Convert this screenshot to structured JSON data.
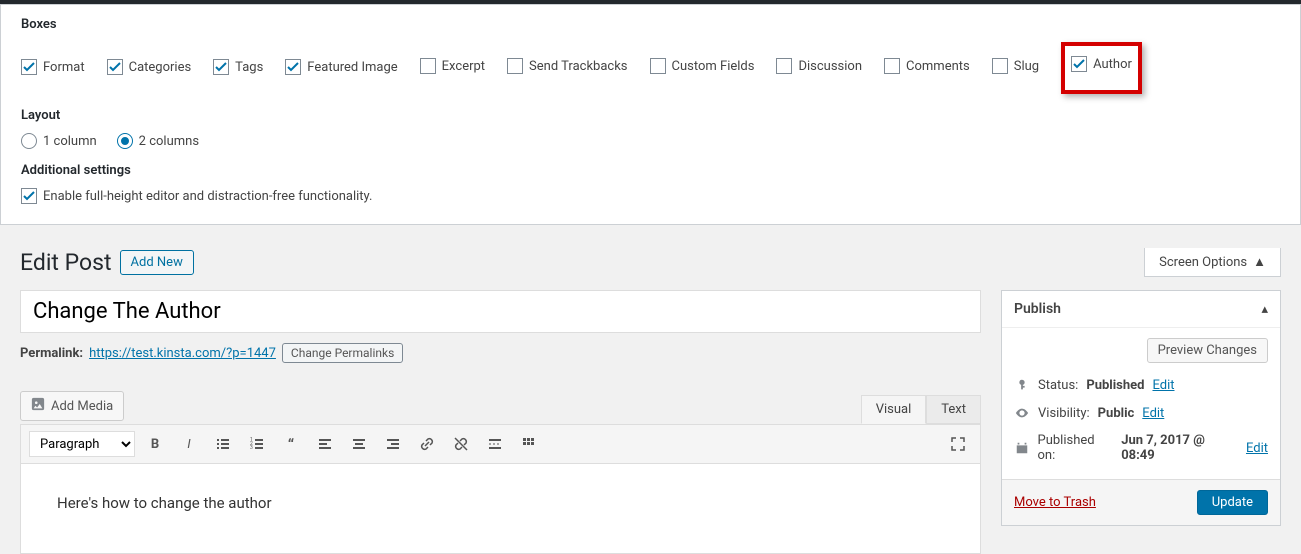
{
  "screen_options": {
    "sections": {
      "boxes_heading": "Boxes",
      "layout_heading": "Layout",
      "additional_heading": "Additional settings"
    },
    "boxes": [
      {
        "id": "format",
        "label": "Format",
        "checked": true
      },
      {
        "id": "categories",
        "label": "Categories",
        "checked": true
      },
      {
        "id": "tags",
        "label": "Tags",
        "checked": true
      },
      {
        "id": "featured-image",
        "label": "Featured Image",
        "checked": true
      },
      {
        "id": "excerpt",
        "label": "Excerpt",
        "checked": false
      },
      {
        "id": "trackbacks",
        "label": "Send Trackbacks",
        "checked": false
      },
      {
        "id": "custom-fields",
        "label": "Custom Fields",
        "checked": false
      },
      {
        "id": "discussion",
        "label": "Discussion",
        "checked": false
      },
      {
        "id": "comments",
        "label": "Comments",
        "checked": false
      },
      {
        "id": "slug",
        "label": "Slug",
        "checked": false
      },
      {
        "id": "author",
        "label": "Author",
        "checked": true,
        "highlight": true
      }
    ],
    "layout": [
      {
        "id": "col1",
        "label": "1 column",
        "selected": false
      },
      {
        "id": "col2",
        "label": "2 columns",
        "selected": true
      }
    ],
    "additional": {
      "label": "Enable full-height editor and distraction-free functionality.",
      "checked": true
    },
    "tab_label": "Screen Options"
  },
  "header": {
    "page_title": "Edit Post",
    "add_new": "Add New"
  },
  "post": {
    "title": "Change The Author",
    "permalink_label": "Permalink:",
    "permalink_url": "https://test.kinsta.com/?p=1447",
    "change_permalinks": "Change Permalinks",
    "add_media": "Add Media",
    "tabs": {
      "visual": "Visual",
      "text": "Text"
    },
    "paragraph_dropdown": "Paragraph",
    "body_text": "Here's how to change the author"
  },
  "publish": {
    "heading": "Publish",
    "preview": "Preview Changes",
    "status_label": "Status:",
    "status_value": "Published",
    "visibility_label": "Visibility:",
    "visibility_value": "Public",
    "published_label": "Published on:",
    "published_value": "Jun 7, 2017 @ 08:49",
    "edit": "Edit",
    "trash": "Move to Trash",
    "update": "Update"
  }
}
